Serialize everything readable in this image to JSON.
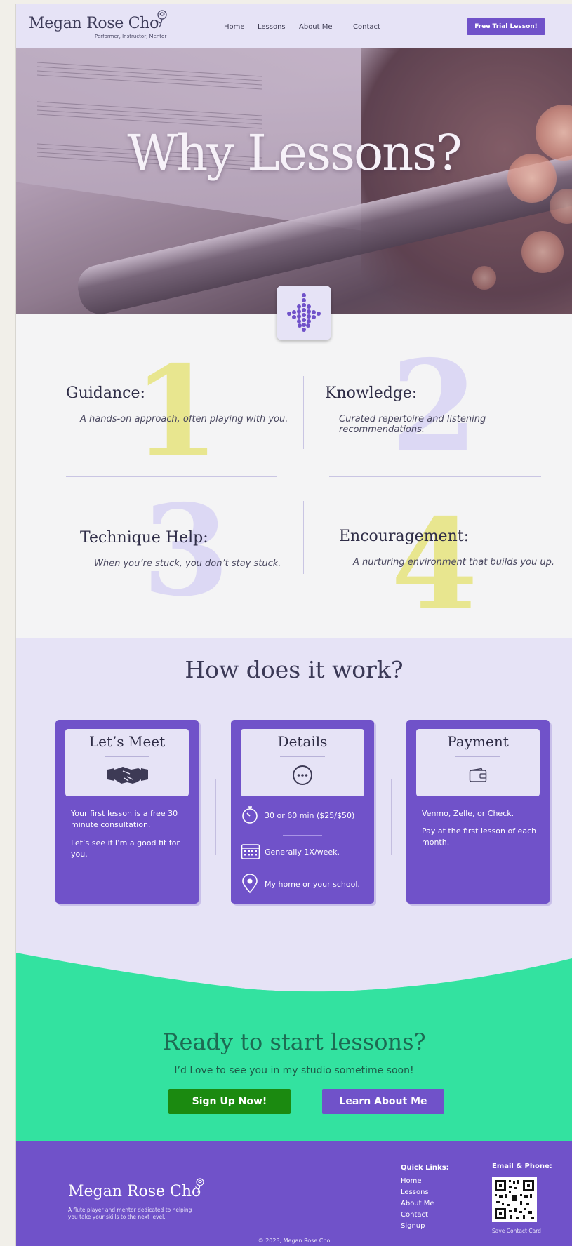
{
  "header": {
    "logo_name": "Megan Rose Cho",
    "logo_tagline": "Performer, Instructor, Mentor",
    "nav": [
      "Home",
      "Lessons",
      "About Me",
      "Contact"
    ],
    "cta": "Free Trial Lesson!"
  },
  "hero": {
    "title": "Why Lessons?"
  },
  "reasons": [
    {
      "number": "1",
      "title": "Guidance:",
      "desc": "A hands-on approach, often playing with you."
    },
    {
      "number": "2",
      "title": "Knowledge:",
      "desc": "Curated repertoire and listening recommendations."
    },
    {
      "number": "3",
      "title": "Technique Help:",
      "desc": "When you’re stuck, you don’t stay stuck."
    },
    {
      "number": "4",
      "title": "Encouragement:",
      "desc": "A nurturing environment that builds you up."
    }
  ],
  "how": {
    "title": "How does it work?",
    "cards": [
      {
        "title": "Let’s Meet",
        "icon": "handshake-icon",
        "paragraphs": [
          "Your first lesson is a free 30 minute consultation.",
          "Let’s see if I’m a good fit for you."
        ]
      },
      {
        "title": "Details",
        "icon": "more-icon",
        "rows": [
          {
            "icon": "stopwatch-icon",
            "text": "30 or 60 min ($25/$50)"
          },
          {
            "icon": "calendar-icon",
            "text": "Generally 1X/week."
          },
          {
            "icon": "location-pin-icon",
            "text": "My home or your school."
          }
        ]
      },
      {
        "title": "Payment",
        "icon": "wallet-icon",
        "paragraphs": [
          "Venmo, Zelle, or Check.",
          "Pay at the first lesson of each month."
        ]
      }
    ]
  },
  "cta": {
    "title": "Ready to start lessons?",
    "subtitle": "I’d Love to see you in my studio sometime soon!",
    "primary": "Sign Up Now!",
    "secondary": "Learn About Me"
  },
  "footer": {
    "name": "Megan Rose Cho",
    "description": "A flute player and mentor dedicated to helping you take your skills to the next level.",
    "quick_links_title": "Quick Links:",
    "links": [
      "Home",
      "Lessons",
      "About Me",
      "Contact",
      "Signup"
    ],
    "contact_title": "Email & Phone:",
    "save_contact": "Save Contact Card",
    "copyright": "© 2023, Megan Rose Cho"
  },
  "colors": {
    "purple": "#7052c9",
    "lavender": "#e6e3f6",
    "mint": "#33e2a0",
    "green_button": "#1b8a10",
    "yellow_numeral": "#e8e68f",
    "lavender_numeral": "#dcd8f4"
  }
}
